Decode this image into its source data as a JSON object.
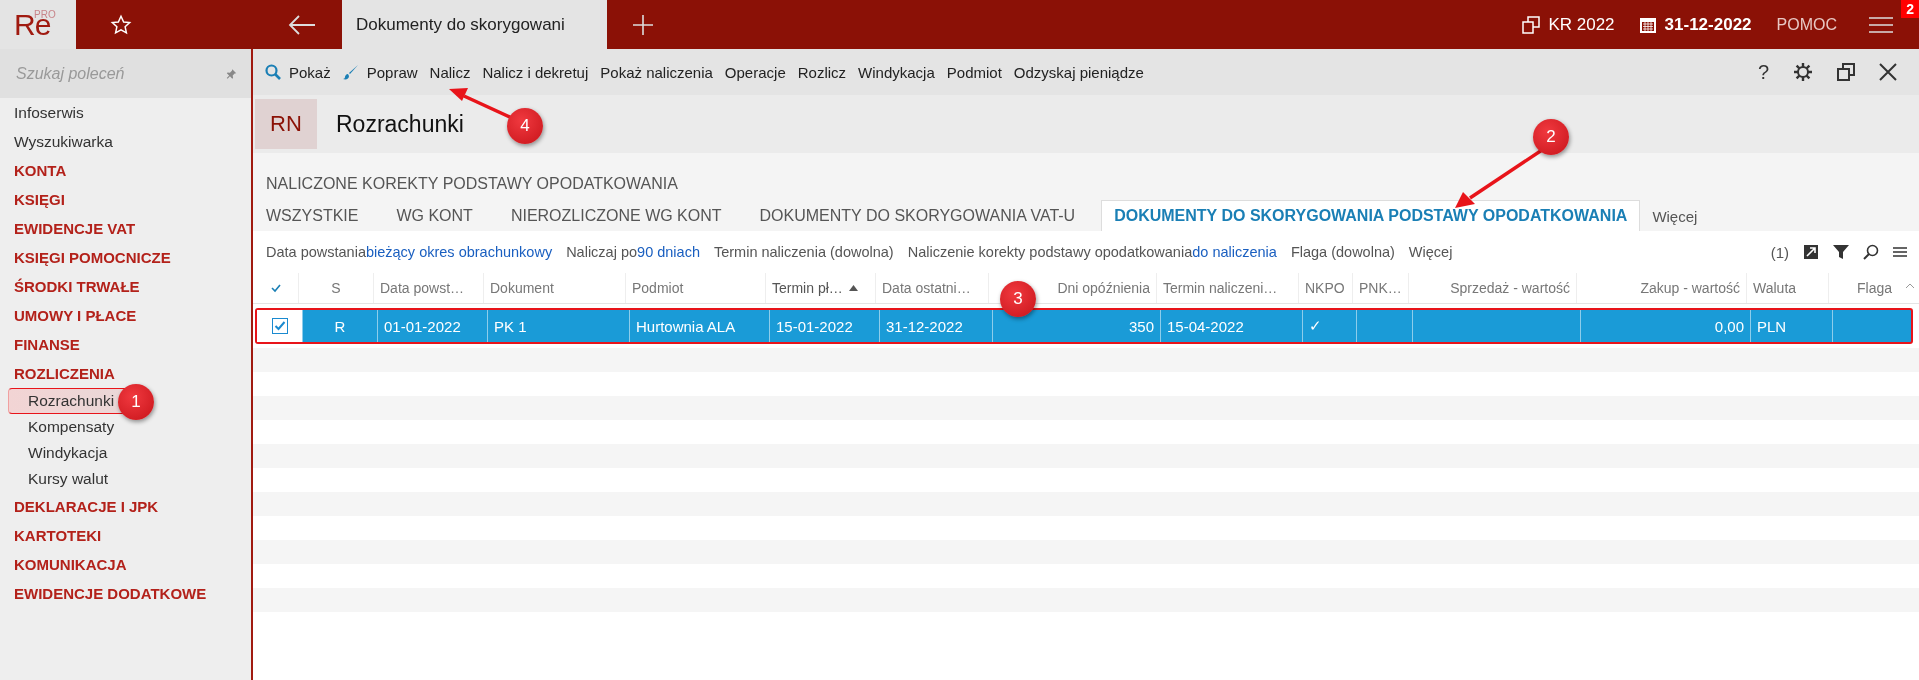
{
  "topbar": {
    "logo": "Re",
    "logo_sup": "PRO",
    "doc_tab": "Dokumenty do skorygowani",
    "year": "KR 2022",
    "date": "31-12-2022",
    "help": "POMOC",
    "menu_badge": "2"
  },
  "sidebar": {
    "search": {
      "placeholder": "Szukaj poleceń"
    },
    "items": [
      {
        "label": "Infoserwis",
        "kind": "link",
        "selected": false
      },
      {
        "label": "Wyszukiwarka",
        "kind": "link",
        "selected": false
      },
      {
        "label": "KONTA",
        "kind": "section",
        "selected": false
      },
      {
        "label": "KSIĘGI",
        "kind": "section",
        "selected": false
      },
      {
        "label": "EWIDENCJE VAT",
        "kind": "section",
        "selected": false
      },
      {
        "label": "KSIĘGI POMOCNICZE",
        "kind": "section",
        "selected": false
      },
      {
        "label": "ŚRODKI TRWAŁE",
        "kind": "section",
        "selected": false
      },
      {
        "label": "UMOWY I PŁACE",
        "kind": "section",
        "selected": false
      },
      {
        "label": "FINANSE",
        "kind": "section",
        "selected": false
      },
      {
        "label": "ROZLICZENIA",
        "kind": "section",
        "selected": false,
        "children": [
          {
            "label": "Rozrachunki",
            "selected": true
          },
          {
            "label": "Kompensaty",
            "selected": false
          },
          {
            "label": "Windykacja",
            "selected": false
          },
          {
            "label": "Kursy walut",
            "selected": false
          }
        ]
      },
      {
        "label": "DEKLARACJE I JPK",
        "kind": "section",
        "selected": false
      },
      {
        "label": "KARTOTEKI",
        "kind": "section",
        "selected": false
      },
      {
        "label": "KOMUNIKACJA",
        "kind": "section",
        "selected": false
      },
      {
        "label": "EWIDENCJE DODATKOWE",
        "kind": "section",
        "selected": false
      }
    ]
  },
  "toolbar": {
    "actions": [
      {
        "label": "Pokaż",
        "kind": "search"
      },
      {
        "label": "Popraw",
        "kind": "brush"
      },
      {
        "label": "Nalicz",
        "kind": "plain"
      },
      {
        "label": "Nalicz i dekretuj",
        "kind": "plain"
      },
      {
        "label": "Pokaż naliczenia",
        "kind": "plain"
      },
      {
        "label": "Operacje",
        "kind": "plain"
      },
      {
        "label": "Rozlicz",
        "kind": "plain"
      },
      {
        "label": "Windykacja",
        "kind": "plain"
      },
      {
        "label": "Podmiot",
        "kind": "plain"
      },
      {
        "label": "Odzyskaj pieniądze",
        "kind": "plain"
      }
    ],
    "help": "?"
  },
  "header": {
    "badge": "RN",
    "title": "Rozrachunki"
  },
  "subtab": "NALICZONE KOREKTY PODSTAWY OPODATKOWANIA",
  "tabs": [
    {
      "label": "WSZYSTKIE",
      "selected": false
    },
    {
      "label": "WG KONT",
      "selected": false
    },
    {
      "label": "NIEROZLICZONE WG KONT",
      "selected": false
    },
    {
      "label": "DOKUMENTY DO SKORYGOWANIA VAT-U",
      "selected": false
    },
    {
      "label": "DOKUMENTY DO SKORYGOWANIA PODSTAWY OPODATKOWANIA",
      "selected": true
    }
  ],
  "tabs_more": "Więcej",
  "filters": [
    {
      "label": "Data powstania",
      "value": "bieżący okres obrachunkowy"
    },
    {
      "label": "Naliczaj po",
      "value": "90 dniach"
    },
    {
      "label": "Termin naliczenia (dowolna)"
    },
    {
      "label": "Naliczenie korekty podstawy opodatkowania",
      "value": "do naliczenia"
    },
    {
      "label": "Flaga (dowolna)"
    },
    {
      "label": "Więcej"
    }
  ],
  "filter_count": "(1)",
  "table": {
    "all_checked": true,
    "columns": [
      {
        "label": "S",
        "sorted": false
      },
      {
        "label": "Data powst…",
        "sorted": false
      },
      {
        "label": "Dokument",
        "sorted": false
      },
      {
        "label": "Podmiot",
        "sorted": false
      },
      {
        "label": "Termin pł…",
        "sorted": true
      },
      {
        "label": "Data ostatni…",
        "sorted": false
      },
      {
        "label": "Dni opóźnienia",
        "sorted": false
      },
      {
        "label": "Termin naliczeni…",
        "sorted": false
      },
      {
        "label": "NKPO",
        "sorted": false
      },
      {
        "label": "PNK…",
        "sorted": false
      },
      {
        "label": "Sprzedaż - wartość",
        "sorted": false
      },
      {
        "label": "Zakup - wartość",
        "sorted": false
      },
      {
        "label": "Waluta",
        "sorted": false
      },
      {
        "label": "Flaga",
        "sorted": false
      }
    ],
    "rows": [
      {
        "selected": true,
        "checked": true,
        "cells": [
          "R",
          "01-01-2022",
          "PK 1",
          "Hurtownia ALA",
          "15-01-2022",
          "31-12-2022",
          "350",
          "15-04-2022",
          "✓",
          null,
          null,
          "0,00",
          "PLN",
          null
        ]
      }
    ]
  },
  "annotations": [
    {
      "label": "1"
    },
    {
      "label": "2"
    },
    {
      "label": "3"
    },
    {
      "label": "4"
    }
  ]
}
